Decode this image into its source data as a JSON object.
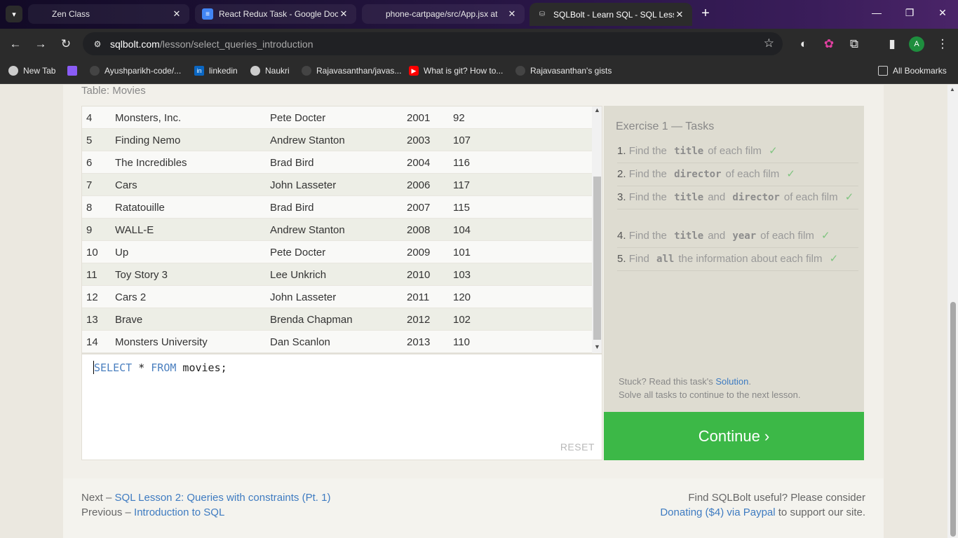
{
  "browser": {
    "tabs": [
      {
        "title": "Zen Class",
        "active": false
      },
      {
        "title": "React Redux Task - Google Doc",
        "active": false
      },
      {
        "title": "phone-cartpage/src/App.jsx at",
        "active": false
      },
      {
        "title": "SQLBolt - Learn SQL - SQL Lesso",
        "active": true
      }
    ],
    "url_host": "sqlbolt.com",
    "url_path": "/lesson/select_queries_introduction",
    "profile_initial": "A",
    "bookmarks": [
      "New Tab",
      "Ayushparikh-code/...",
      "linkedin",
      "Naukri",
      "Rajavasanthan/javas...",
      "What is git? How to...",
      "Rajavasanthan's gists"
    ],
    "all_bookmarks": "All Bookmarks"
  },
  "lesson": {
    "table_caption": "Table: Movies",
    "rows": [
      {
        "id": "4",
        "title": "Monsters, Inc.",
        "director": "Pete Docter",
        "year": "2001",
        "length": "92"
      },
      {
        "id": "5",
        "title": "Finding Nemo",
        "director": "Andrew Stanton",
        "year": "2003",
        "length": "107"
      },
      {
        "id": "6",
        "title": "The Incredibles",
        "director": "Brad Bird",
        "year": "2004",
        "length": "116"
      },
      {
        "id": "7",
        "title": "Cars",
        "director": "John Lasseter",
        "year": "2006",
        "length": "117"
      },
      {
        "id": "8",
        "title": "Ratatouille",
        "director": "Brad Bird",
        "year": "2007",
        "length": "115"
      },
      {
        "id": "9",
        "title": "WALL-E",
        "director": "Andrew Stanton",
        "year": "2008",
        "length": "104"
      },
      {
        "id": "10",
        "title": "Up",
        "director": "Pete Docter",
        "year": "2009",
        "length": "101"
      },
      {
        "id": "11",
        "title": "Toy Story 3",
        "director": "Lee Unkrich",
        "year": "2010",
        "length": "103"
      },
      {
        "id": "12",
        "title": "Cars 2",
        "director": "John Lasseter",
        "year": "2011",
        "length": "120"
      },
      {
        "id": "13",
        "title": "Brave",
        "director": "Brenda Chapman",
        "year": "2012",
        "length": "102"
      },
      {
        "id": "14",
        "title": "Monsters University",
        "director": "Dan Scanlon",
        "year": "2013",
        "length": "110"
      }
    ],
    "editor": {
      "kw_select": "SELECT",
      "star": " * ",
      "kw_from": "FROM",
      "rest": " movies;",
      "reset_label": "RESET"
    },
    "tasks": {
      "title": "Exercise 1 — Tasks",
      "check": "✓",
      "items": [
        {
          "num": "1.",
          "pre": "Find the",
          "c1": "title",
          "mid": "",
          "c2": "",
          "post": "of each film"
        },
        {
          "num": "2.",
          "pre": "Find the",
          "c1": "director",
          "mid": "",
          "c2": "",
          "post": "of each film"
        },
        {
          "num": "3.",
          "pre": "Find the",
          "c1": "title",
          "mid": "and",
          "c2": "director",
          "post": "of each film"
        },
        {
          "num": "4.",
          "pre": "Find the",
          "c1": "title",
          "mid": "and",
          "c2": "year",
          "post": "of each film"
        },
        {
          "num": "5.",
          "pre": "Find",
          "c1": "all",
          "mid": "",
          "c2": "",
          "post": "the information about each film"
        }
      ],
      "stuck_pre": "Stuck? Read this task's",
      "solution_link": "Solution",
      "stuck_post": ".",
      "solve_all": "Solve all tasks to continue to the next lesson.",
      "continue_label": "Continue ›"
    },
    "footer": {
      "next_prefix": "Next – ",
      "next_link": "SQL Lesson 2: Queries with constraints (Pt. 1)",
      "prev_prefix": "Previous – ",
      "prev_link": "Introduction to SQL",
      "donate_line1": "Find SQLBolt useful? Please consider",
      "donate_link": "Donating ($4) via Paypal",
      "donate_suffix": " to support our site."
    }
  },
  "colors": {
    "continue_green": "#3cb847",
    "link_blue": "#3e7bc1",
    "check_green": "#7fc47f"
  }
}
